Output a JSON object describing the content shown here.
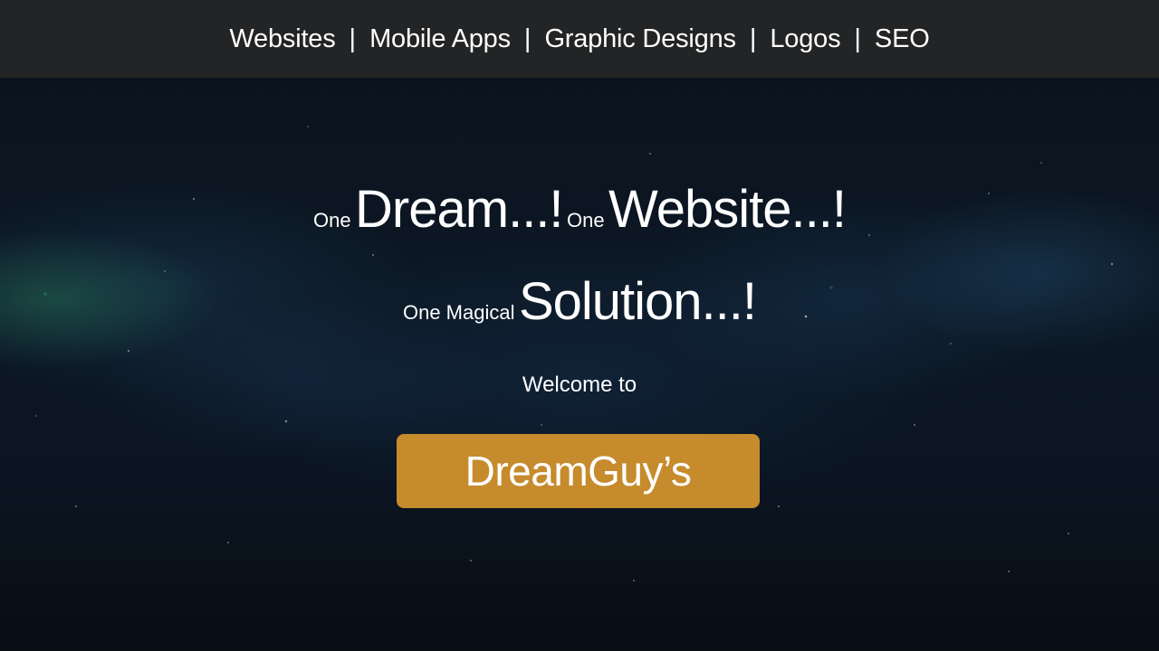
{
  "nav": {
    "items": [
      "Websites",
      "Mobile Apps",
      "Graphic Designs",
      "Logos",
      "SEO"
    ],
    "separator": "|"
  },
  "hero": {
    "line1": {
      "one_a": "One",
      "dream": "Dream...!",
      "one_b": "One",
      "website": "Website...!"
    },
    "line2": {
      "one_magical": "One Magical",
      "solution": "Solution...!"
    },
    "welcome": "Welcome to",
    "brand_button": "DreamGuy’s"
  },
  "colors": {
    "navbar_bg": "#232425",
    "brand_button_bg": "#c68b2c",
    "text": "#ffffff",
    "background": "#0b1521"
  }
}
